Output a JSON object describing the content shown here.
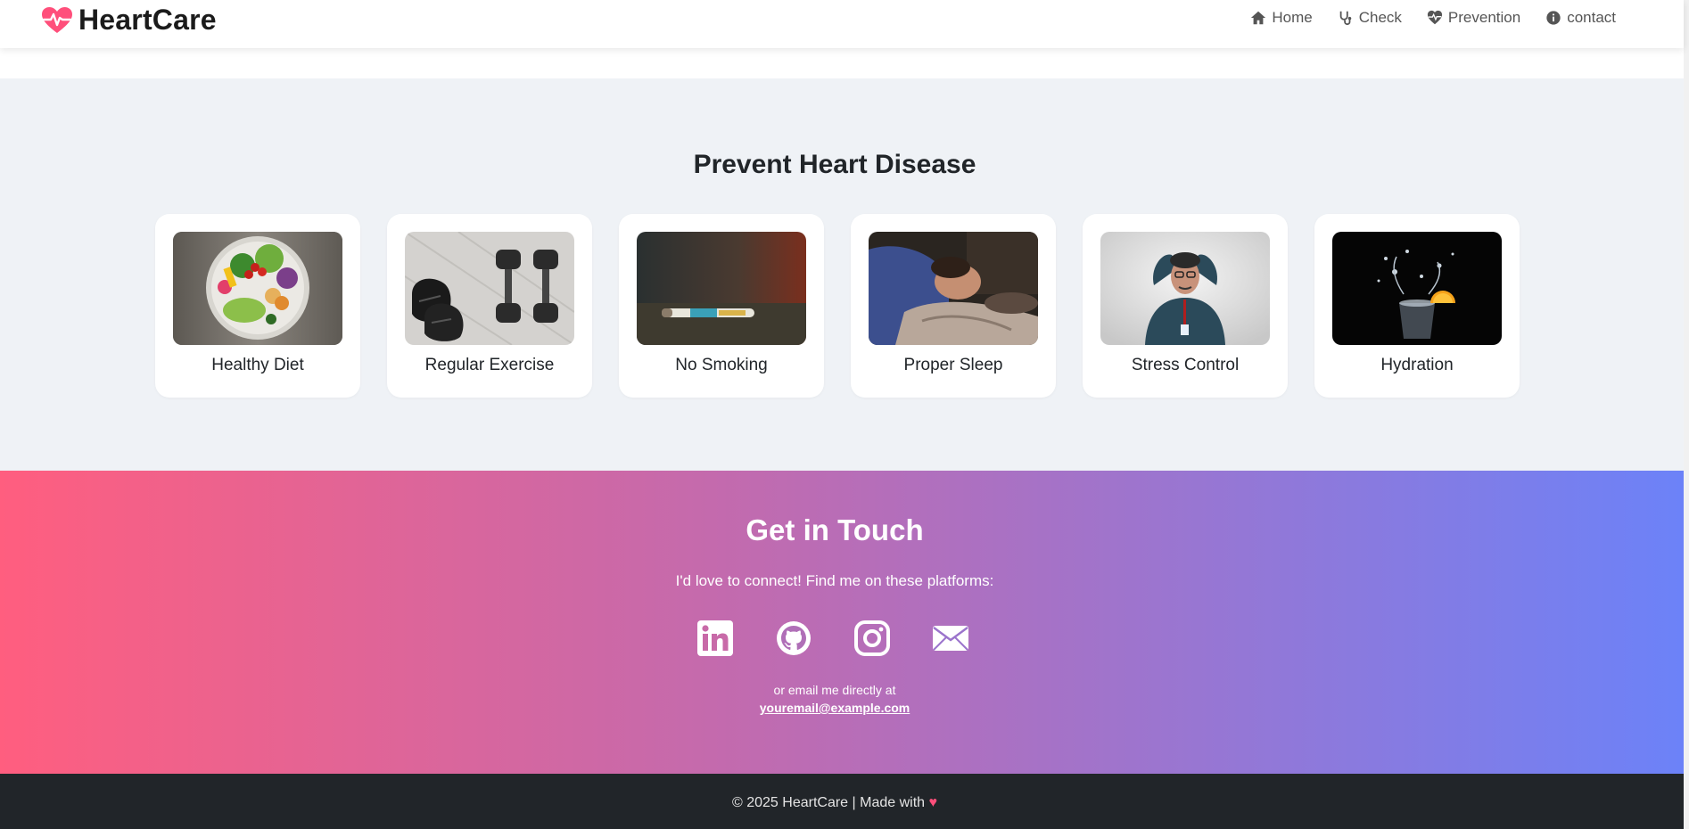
{
  "brand": {
    "name": "HeartCare",
    "accent": "#ff4f7b"
  },
  "nav": {
    "items": [
      {
        "label": "Home",
        "icon": "home-icon"
      },
      {
        "label": "Check",
        "icon": "stethoscope-icon"
      },
      {
        "label": "Prevention",
        "icon": "heart-pulse-icon"
      },
      {
        "label": "contact",
        "icon": "info-circle-icon"
      }
    ]
  },
  "prevention": {
    "title": "Prevent Heart Disease",
    "cards": [
      {
        "label": "Healthy Diet",
        "image": "salad-bowl-photo"
      },
      {
        "label": "Regular Exercise",
        "image": "dumbbells-sneakers-photo"
      },
      {
        "label": "No Smoking",
        "image": "e-cigarette-photo"
      },
      {
        "label": "Proper Sleep",
        "image": "sleeping-man-photo"
      },
      {
        "label": "Stress Control",
        "image": "stressed-man-photo"
      },
      {
        "label": "Hydration",
        "image": "water-splash-photo"
      }
    ]
  },
  "contact": {
    "title": "Get in Touch",
    "subtitle": "I'd love to connect! Find me on these platforms:",
    "socials": [
      "linkedin-icon",
      "github-icon",
      "instagram-icon",
      "envelope-icon"
    ],
    "or_text": "or email me directly at",
    "email": "youremail@example.com",
    "gradient": [
      "#ff5e7f",
      "#c06bb0",
      "#6c82f8"
    ]
  },
  "footer": {
    "text": "© 2025 HeartCare | Made with",
    "heart": "♥"
  }
}
